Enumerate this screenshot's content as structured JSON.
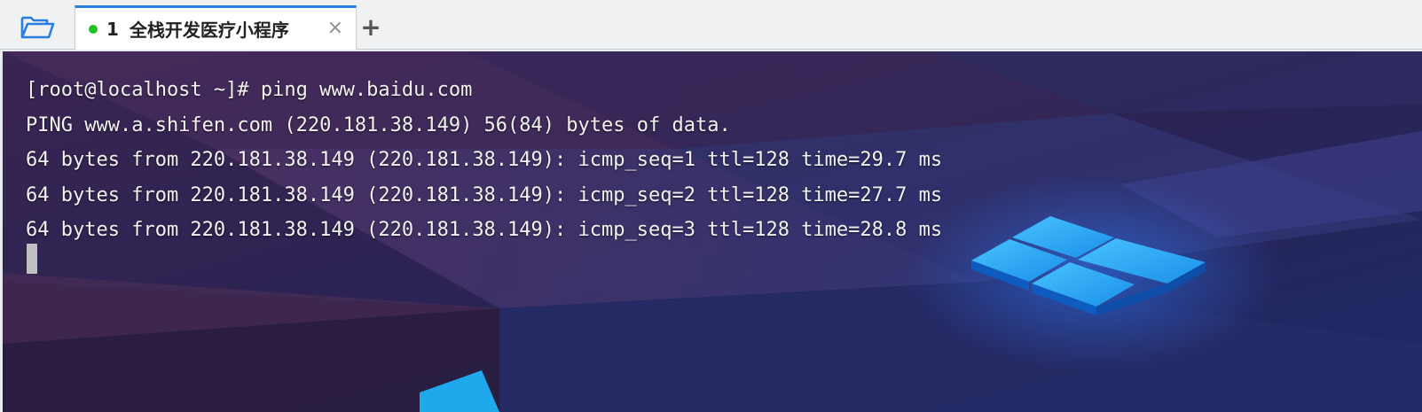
{
  "colors": {
    "tab_accent": "#2a7de1",
    "status_dot": "#22c020",
    "folder_icon": "#2a7de1",
    "terminal_text": "#f2f2f2"
  },
  "toolbar": {
    "open_icon": "folder-open-icon"
  },
  "tabs": [
    {
      "number": "1",
      "title": "全栈开发医疗小程序",
      "status_icon": "connected-dot-icon",
      "close_label": "×"
    }
  ],
  "add_tab_label": "+",
  "terminal": {
    "lines": [
      "[root@localhost ~]# ping www.baidu.com",
      "PING www.a.shifen.com (220.181.38.149) 56(84) bytes of data.",
      "64 bytes from 220.181.38.149 (220.181.38.149): icmp_seq=1 ttl=128 time=29.7 ms",
      "64 bytes from 220.181.38.149 (220.181.38.149): icmp_seq=2 ttl=128 time=27.7 ms",
      "64 bytes from 220.181.38.149 (220.181.38.149): icmp_seq=3 ttl=128 time=28.8 ms"
    ]
  }
}
